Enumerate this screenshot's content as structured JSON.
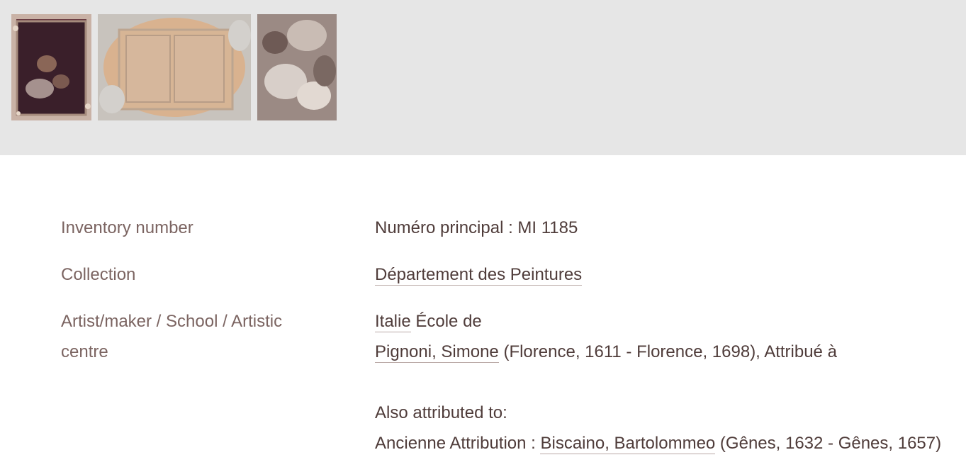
{
  "thumbnails": [
    {
      "alt": "thumbnail-1"
    },
    {
      "alt": "thumbnail-2"
    },
    {
      "alt": "thumbnail-3"
    }
  ],
  "details": {
    "inventory": {
      "label": "Inventory number",
      "value": "Numéro principal : MI 1185"
    },
    "collection": {
      "label": "Collection",
      "link": "Département des Peintures"
    },
    "artist": {
      "label": "Artist/maker / School / Artistic centre",
      "school_link": "Italie",
      "school_suffix": " École de",
      "artist_link": "Pignoni, Simone",
      "artist_suffix": " (Florence, 1611 - Florence, 1698), Attribué à",
      "also_heading": "Also attributed to:",
      "former_prefix": "Ancienne Attribution : ",
      "former_link": "Biscaino, Bartolommeo",
      "former_suffix": " (Gênes, 1632 - Gênes, 1657)"
    }
  },
  "colors": {
    "label": "#7b6461",
    "value": "#4f3c3a",
    "strip_bg": "#e6e6e6",
    "link_underline": "#b9a9a6"
  }
}
